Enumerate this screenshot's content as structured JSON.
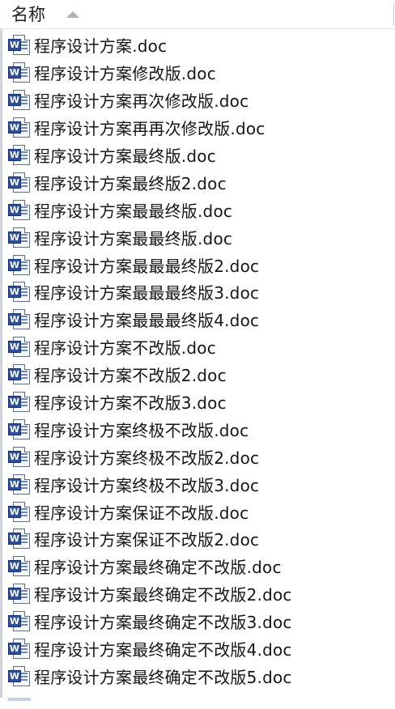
{
  "header": {
    "column_name": "名称",
    "sort_icon": "sort-ascending-icon"
  },
  "icons": {
    "file_icon": "word-document-icon",
    "badge_letter": "W",
    "badge_color": "#2b4f9e"
  },
  "files": [
    "程序设计方案.doc",
    "程序设计方案修改版.doc",
    "程序设计方案再次修改版.doc",
    "程序设计方案再再次修改版.doc",
    "程序设计方案最终版.doc",
    "程序设计方案最终版2.doc",
    "程序设计方案最最终版.doc",
    "程序设计方案最最终版.doc",
    "程序设计方案最最最终版2.doc",
    "程序设计方案最最最终版3.doc",
    "程序设计方案最最最终版4.doc",
    "程序设计方案不改版.doc",
    "程序设计方案不改版2.doc",
    "程序设计方案不改版3.doc",
    "程序设计方案终极不改版.doc",
    "程序设计方案终极不改版2.doc",
    "程序设计方案终极不改版3.doc",
    "程序设计方案保证不改版.doc",
    "程序设计方案保证不改版2.doc",
    "程序设计方案最终确定不改版.doc",
    "程序设计方案最终确定不改版2.doc",
    "程序设计方案最终确定不改版3.doc",
    "程序设计方案最终确定不改版4.doc",
    "程序设计方案最终确定不改版5.doc"
  ]
}
